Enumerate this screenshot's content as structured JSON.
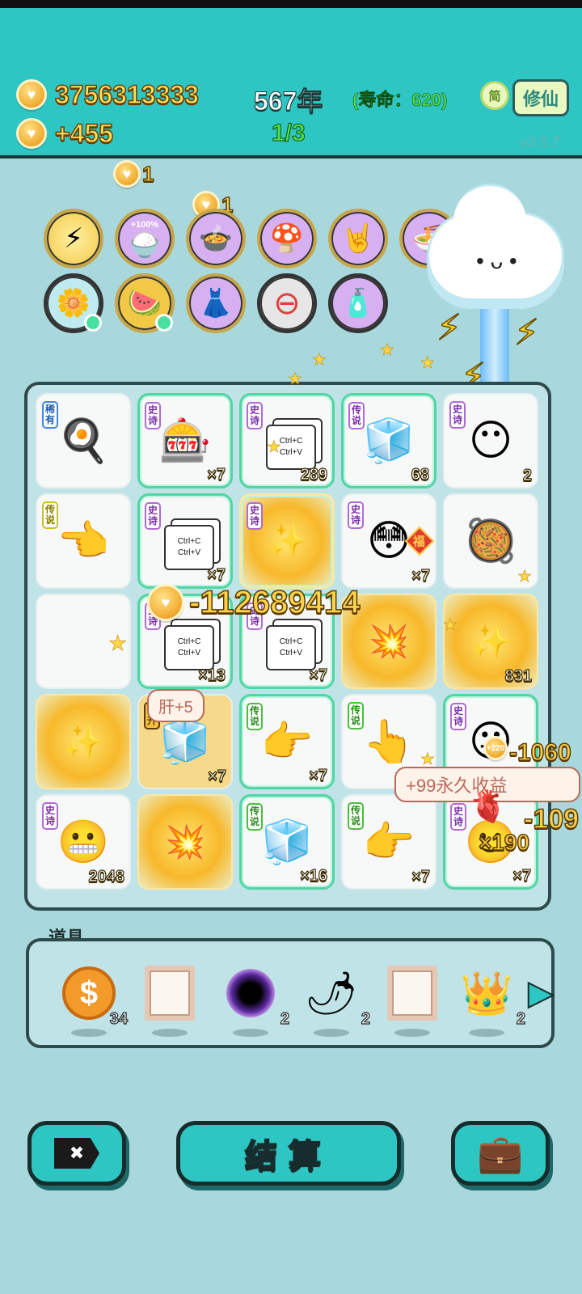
{
  "header": {
    "coins": "3756313333",
    "income": "+455",
    "year": "567年",
    "lifespan": "(寿命：620)",
    "round": "1/3",
    "simp_label": "简",
    "xiuxian_label": "修仙",
    "version": "v3.5.7"
  },
  "floating": {
    "coin_gain_1": "1",
    "coin_gain_2": "1",
    "skill_badge": "+100%",
    "big_loss": "-112689414",
    "liver_bubble": "肝+5",
    "perm_bubble": "+99永久收益",
    "right_loss_1": "-1060",
    "right_loss_2": "-109",
    "multiplier": "×190",
    "coin_badge": "+220"
  },
  "skills": [
    {
      "name": "lightning-skill-icon"
    },
    {
      "name": "rice-bowl-skill-icon"
    },
    {
      "name": "rice-cooker-skill-icon"
    },
    {
      "name": "mushroom-cloud-skill-icon"
    },
    {
      "name": "rock-hand-skill-icon"
    },
    {
      "name": "noodle-bowl-skill-icon"
    },
    {
      "name": "potted-flower-skill-icon"
    },
    {
      "name": "fruit-basket-skill-icon"
    },
    {
      "name": "skirt-skill-icon"
    },
    {
      "name": "minus-skill-icon"
    },
    {
      "name": "spray-bottle-skill-icon"
    }
  ],
  "board": {
    "cells": [
      {
        "tag": "稀有",
        "icon": "pressure-cooker",
        "count": ""
      },
      {
        "tag": "史诗",
        "icon": "capsule-machine",
        "count": "×7"
      },
      {
        "tag": "史诗",
        "icon": "copy-paste",
        "paper": "Ctrl+C Ctrl+V",
        "count": "289"
      },
      {
        "tag": "传说",
        "icon": "fridge",
        "count": "68"
      },
      {
        "tag": "史诗",
        "icon": "face",
        "count": "2"
      },
      {
        "tag": "传说",
        "icon": "pointing-hand",
        "count": ""
      },
      {
        "tag": "史诗",
        "icon": "copy-paste",
        "paper": "Ctrl+C Ctrl+V",
        "count": "×7"
      },
      {
        "tag": "史诗",
        "icon": "gold-burst",
        "count": ""
      },
      {
        "tag": "史诗",
        "icon": "face-fortune",
        "count": "×7",
        "badge": "福"
      },
      {
        "tag": "",
        "icon": "pot",
        "count": ""
      },
      {
        "tag": "",
        "icon": "empty",
        "count": ""
      },
      {
        "tag": "史诗",
        "icon": "copy-paste",
        "paper": "Ctrl+C Ctrl+V",
        "count": "×13"
      },
      {
        "tag": "史诗",
        "icon": "copy-paste",
        "paper": "Ctrl+C Ctrl+V",
        "count": "×7"
      },
      {
        "tag": "",
        "icon": "gold-burst",
        "count": ""
      },
      {
        "tag": "",
        "icon": "gold-burst",
        "count": "831"
      },
      {
        "tag": "",
        "icon": "gold-burst",
        "count": ""
      },
      {
        "tag": "飞升",
        "icon": "fridge",
        "count": "×7"
      },
      {
        "tag": "传说",
        "icon": "pointing-hand",
        "count": "×7"
      },
      {
        "tag": "传说",
        "icon": "pointing-hand",
        "count": ""
      },
      {
        "tag": "史诗",
        "icon": "face-star",
        "count": ""
      },
      {
        "tag": "史诗",
        "icon": "face",
        "count": "2048"
      },
      {
        "tag": "",
        "icon": "gold-burst",
        "count": ""
      },
      {
        "tag": "传说",
        "icon": "fridge",
        "count": "×16"
      },
      {
        "tag": "传说",
        "icon": "pointing-hand",
        "count": "×7"
      },
      {
        "tag": "史诗",
        "icon": "face-green",
        "count": "×7"
      }
    ]
  },
  "items": {
    "title": "道具",
    "list": [
      {
        "name": "dollar-coin",
        "count": "34"
      },
      {
        "name": "picture-frame",
        "count": ""
      },
      {
        "name": "black-hole",
        "count": "2"
      },
      {
        "name": "chili-pepper",
        "count": "2"
      },
      {
        "name": "picture-frame",
        "count": ""
      },
      {
        "name": "crown",
        "count": "2"
      }
    ]
  },
  "buttons": {
    "exit_icon": "✖",
    "settle": "结算",
    "bag_icon": "bag"
  }
}
